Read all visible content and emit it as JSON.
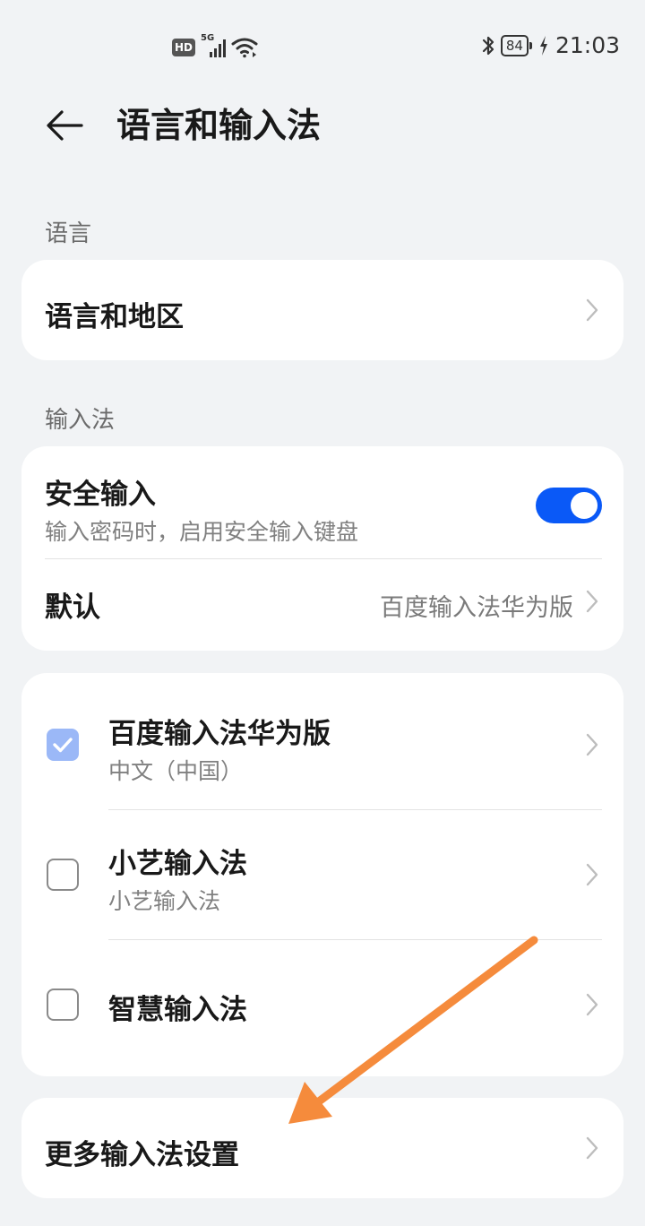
{
  "status_bar": {
    "hd_label": "HD",
    "network_label": "5G",
    "battery_level": "84",
    "time": "21:03",
    "icons": [
      "hd-icon",
      "5g-signal-icon",
      "wifi-icon",
      "bluetooth-icon",
      "battery-icon",
      "charging-icon"
    ]
  },
  "header": {
    "back_icon": "back-arrow-icon",
    "title": "语言和输入法"
  },
  "language_section": {
    "label": "语言",
    "items": [
      {
        "title": "语言和地区"
      }
    ]
  },
  "input_section": {
    "label": "输入法",
    "secure_input": {
      "title": "安全输入",
      "subtitle": "输入密码时，启用安全输入键盘",
      "enabled": true
    },
    "default": {
      "title": "默认",
      "value": "百度输入法华为版"
    }
  },
  "input_methods": [
    {
      "title": "百度输入法华为版",
      "subtitle": "中文（中国）",
      "checked": true
    },
    {
      "title": "小艺输入法",
      "subtitle": "小艺输入法",
      "checked": false
    },
    {
      "title": "智慧输入法",
      "subtitle": "",
      "checked": false
    }
  ],
  "more_settings": {
    "title": "更多输入法设置"
  },
  "colors": {
    "accent": "#0a59f7",
    "checkbox_checked": "#9bb8f7",
    "annotation_arrow": "#f58b3c",
    "background": "#f1f3f5"
  }
}
